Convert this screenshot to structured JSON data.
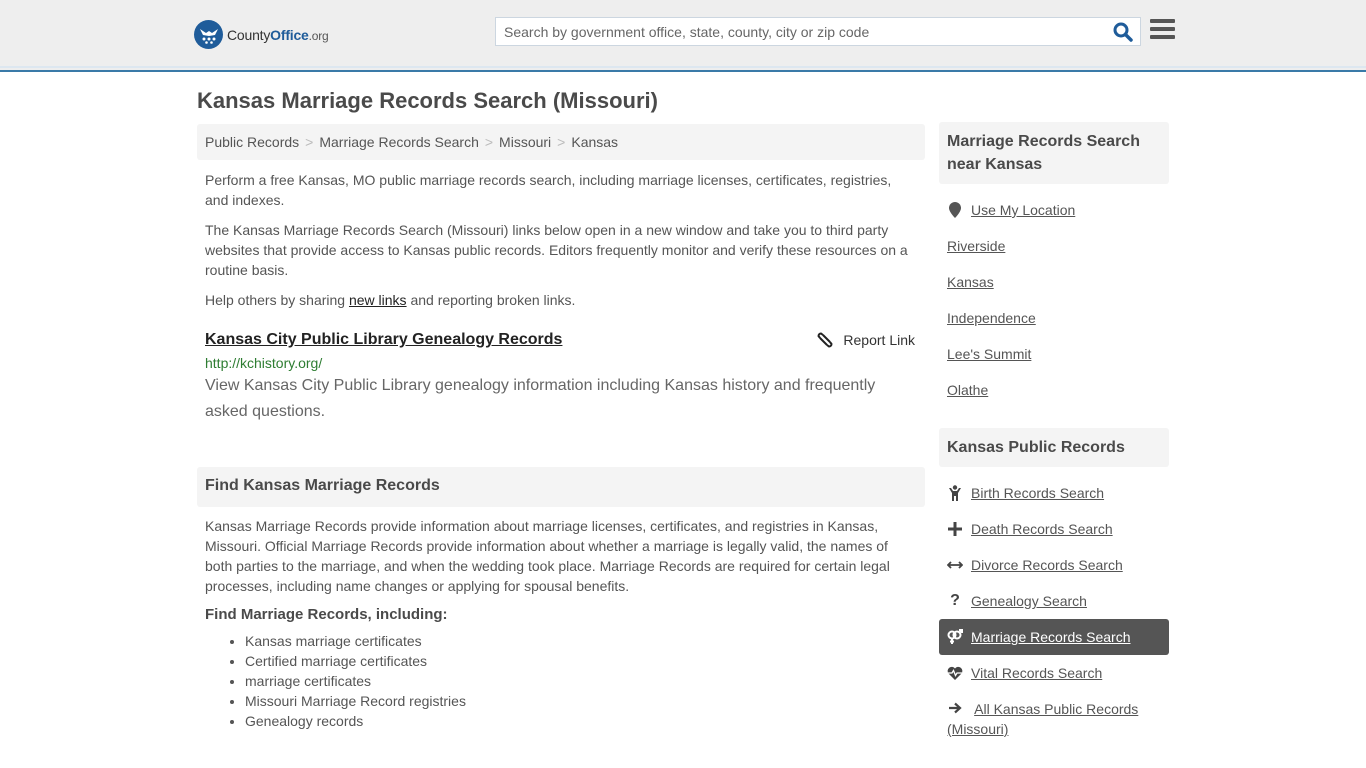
{
  "header": {
    "logo": {
      "county": "County",
      "office": "Office",
      "org": ".org"
    },
    "search_placeholder": "Search by government office, state, county, city or zip code",
    "search_value": ""
  },
  "page_title": "Kansas Marriage Records Search (Missouri)",
  "breadcrumb": [
    "Public Records",
    "Marriage Records Search",
    "Missouri",
    "Kansas"
  ],
  "intro": {
    "p1": "Perform a free Kansas, MO public marriage records search, including marriage licenses, certificates, registries, and indexes.",
    "p2": "The Kansas Marriage Records Search (Missouri) links below open in a new window and take you to third party websites that provide access to Kansas public records. Editors frequently monitor and verify these resources on a routine basis.",
    "p3_before": "Help others by sharing ",
    "p3_link": "new links",
    "p3_after": " and reporting broken links."
  },
  "links": [
    {
      "title": "Kansas City Public Library Genealogy Records",
      "url": "http://kchistory.org/",
      "description": "View Kansas City Public Library genealogy information including Kansas history and frequently asked questions.",
      "report_label": "Report Link"
    }
  ],
  "find_section": {
    "heading": "Find Kansas Marriage Records",
    "body": "Kansas Marriage Records provide information about marriage licenses, certificates, and registries in Kansas, Missouri. Official Marriage Records provide information about whether a marriage is legally valid, the names of both parties to the marriage, and when the wedding took place. Marriage Records are required for certain legal processes, including name changes or applying for spousal benefits.",
    "subheading": "Find Marriage Records, including:",
    "items": [
      "Kansas marriage certificates",
      "Certified marriage certificates",
      "marriage certificates",
      "Missouri Marriage Record registries",
      "Genealogy records"
    ]
  },
  "sidebar": {
    "nearby_heading": "Marriage Records Search near Kansas",
    "use_location": "Use My Location",
    "nearby": [
      "Riverside",
      "Kansas",
      "Independence",
      "Lee's Summit",
      "Olathe"
    ],
    "public_heading": "Kansas Public Records",
    "public_records": [
      {
        "label": "Birth Records Search",
        "icon": "child-icon",
        "active": false
      },
      {
        "label": "Death Records Search",
        "icon": "plus-icon",
        "active": false
      },
      {
        "label": "Divorce Records Search",
        "icon": "arrows-h-icon",
        "active": false
      },
      {
        "label": "Genealogy Search",
        "icon": "question-icon",
        "active": false
      },
      {
        "label": "Marriage Records Search",
        "icon": "venus-mars-icon",
        "active": true
      },
      {
        "label": "Vital Records Search",
        "icon": "heartbeat-icon",
        "active": false
      },
      {
        "label": "All Kansas Public Records (Missouri)",
        "icon": "arrow-right-icon",
        "active": false
      }
    ]
  },
  "colors": {
    "header_bg": "#eeeeee",
    "header_border": "#3a7aa8",
    "brand_blue": "#1f5c9a",
    "url_green": "#2e7d32",
    "active_item_bg": "#555555"
  }
}
